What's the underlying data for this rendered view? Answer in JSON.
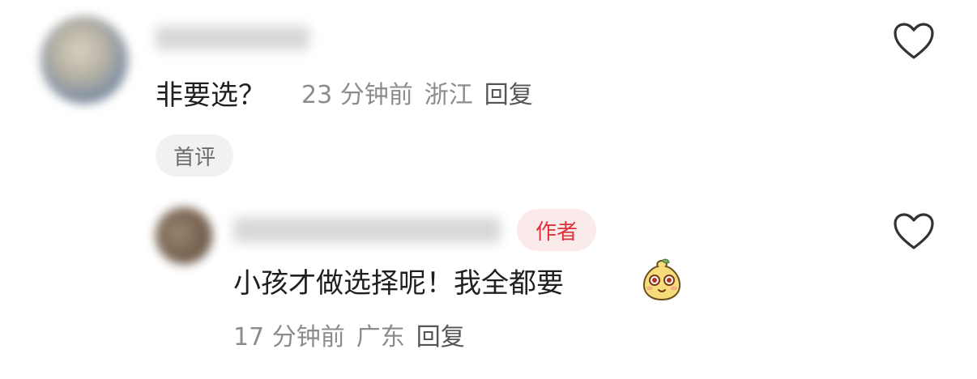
{
  "comments": [
    {
      "text": "非要选？",
      "time": "23 分钟前",
      "location": "浙江",
      "reply_label": "回复",
      "badge": "首评"
    },
    {
      "text": "小孩才做选择呢！我全都要",
      "time": "17 分钟前",
      "location": "广东",
      "reply_label": "回复",
      "author_badge": "作者",
      "emoji_icon": "cute-face-emoji"
    }
  ],
  "colors": {
    "author_badge_bg": "#fbeaea",
    "author_badge_text": "#e0323e",
    "meta_text": "#8c8c8c",
    "badge_bg": "#f1f1f1"
  },
  "icons": {
    "like": "heart-outline-icon"
  }
}
